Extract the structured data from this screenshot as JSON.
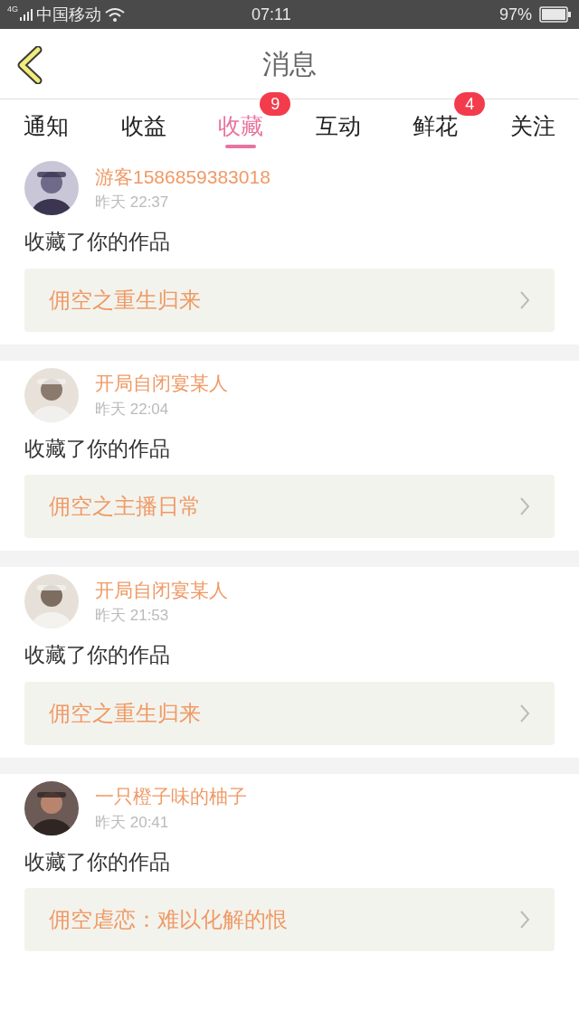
{
  "status_bar": {
    "network": "4G",
    "carrier": "中国移动",
    "time": "07:11",
    "battery": "97%"
  },
  "header": {
    "title": "消息"
  },
  "tabs": [
    {
      "label": "通知",
      "selected": false
    },
    {
      "label": "收益",
      "selected": false
    },
    {
      "label": "收藏",
      "selected": true,
      "badge": "9"
    },
    {
      "label": "互动",
      "selected": false
    },
    {
      "label": "鲜花",
      "selected": false,
      "badge": "4"
    },
    {
      "label": "关注",
      "selected": false
    }
  ],
  "messages": [
    {
      "user": "游客1586859383018",
      "time": "昨天 22:37",
      "action": "收藏了你的作品",
      "work": "佣空之重生归来"
    },
    {
      "user": "开局自闭宴某人",
      "time": "昨天 22:04",
      "action": "收藏了你的作品",
      "work": "佣空之主播日常"
    },
    {
      "user": "开局自闭宴某人",
      "time": "昨天 21:53",
      "action": "收藏了你的作品",
      "work": "佣空之重生归来"
    },
    {
      "user": "一只橙子味的柚子",
      "time": "昨天 20:41",
      "action": "收藏了你的作品",
      "work": "佣空虐恋：难以化解的恨"
    }
  ]
}
